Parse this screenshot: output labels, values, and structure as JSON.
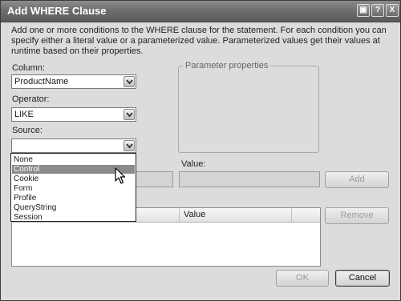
{
  "window": {
    "title": "Add WHERE Clause"
  },
  "titlebar_buttons": {
    "restore": "▣",
    "help": "?",
    "close": "X"
  },
  "intro_text": "Add one or more conditions to the WHERE clause for the statement. For each condition you can specify either a literal value or a parameterized value. Parameterized values get their values at runtime based on their properties.",
  "column": {
    "label": "Column:",
    "value": "ProductName"
  },
  "operator": {
    "label": "Operator:",
    "value": "LIKE"
  },
  "source": {
    "label": "Source:",
    "value": "",
    "options": [
      "None",
      "Control",
      "Cookie",
      "Form",
      "Profile",
      "QueryString",
      "Session"
    ],
    "highlighted": "Control"
  },
  "parameter_properties": {
    "title": "Parameter properties"
  },
  "value_field": {
    "label": "Value:",
    "value": ""
  },
  "buttons": {
    "add": "Add",
    "remove": "Remove",
    "ok": "OK",
    "cancel": "Cancel"
  },
  "conditions_list": {
    "columns": [
      "",
      "Value"
    ],
    "rows": []
  }
}
